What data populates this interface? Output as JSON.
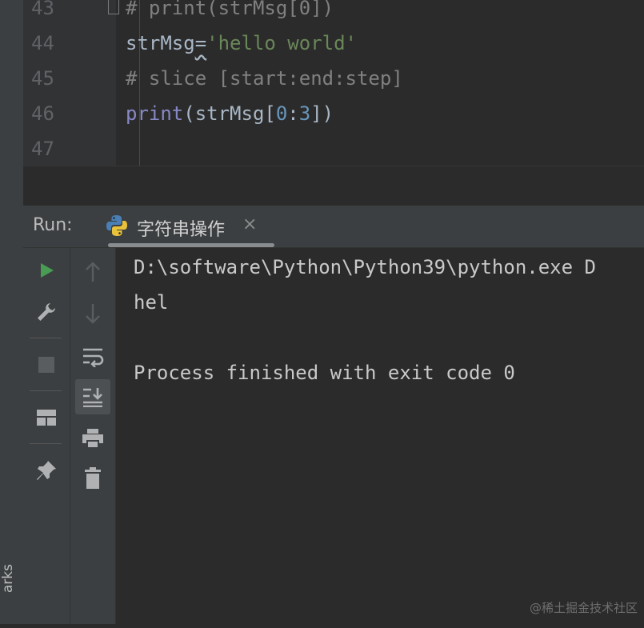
{
  "sidebar": {
    "bookmarks_label": "arks"
  },
  "editor": {
    "lines": [
      {
        "num": "43",
        "text": "# print(strMsg[0])"
      },
      {
        "num": "44",
        "text": "strMsg='hello world'",
        "ident": "strMsg",
        "op": "=",
        "string": "'hello world'"
      },
      {
        "num": "45",
        "text": "# slice [start:end:step]"
      },
      {
        "num": "46",
        "text": "print(strMsg[0:3])",
        "builtin": "print",
        "pre": "(strMsg[",
        "n0": "0",
        "colon": ":",
        "n3": "3",
        "post": "])"
      },
      {
        "num": "47",
        "text": ""
      }
    ]
  },
  "run_panel": {
    "label": "Run:",
    "tab": {
      "title": "字符串操作",
      "close": "×",
      "icon": "python-icon"
    }
  },
  "toolbar_left": [
    "run-icon",
    "wrench-icon",
    "stop-icon",
    "layout-icon",
    "pin-icon"
  ],
  "toolbar_right": [
    "arrow-up-icon",
    "arrow-down-icon",
    "soft-wrap-icon",
    "scroll-to-end-icon",
    "print-icon",
    "trash-icon"
  ],
  "console": {
    "lines": [
      "D:\\software\\Python\\Python39\\python.exe D",
      "hel",
      "",
      "Process finished with exit code 0"
    ]
  },
  "watermark": "@稀土掘金技术社区",
  "colors": {
    "run_green": "#499c54",
    "comment": "#808080",
    "string": "#6a8759",
    "builtin": "#8888c6",
    "number": "#6897bb"
  }
}
